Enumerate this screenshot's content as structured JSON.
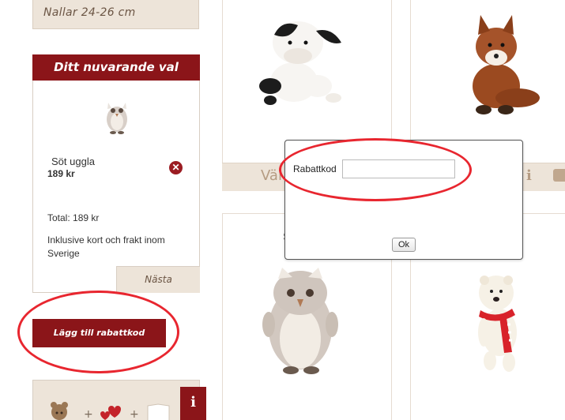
{
  "sidebar": {
    "size_option": "Nallar 24-26 cm",
    "selection": {
      "title": "Ditt nuvarande val",
      "item_name": "Söt uggla",
      "item_price": "189 kr",
      "total": "Total: 189 kr",
      "note": "Inklusive kort och frakt inom Sverige",
      "next_label": "Nästa"
    },
    "discount_button_label": "Lägg till rabattkod",
    "info_tab_label": "i"
  },
  "grid": {
    "card1_bar_text": "Väl",
    "card_info_label": "i",
    "card3_partial_text": "S"
  },
  "dialog": {
    "label": "Rabattkod",
    "input_value": "",
    "input_placeholder": "",
    "ok_label": "Ok"
  },
  "colors": {
    "brand_red": "#8b1519",
    "beige": "#ede4d9",
    "highlight_ring": "#e8262f"
  }
}
